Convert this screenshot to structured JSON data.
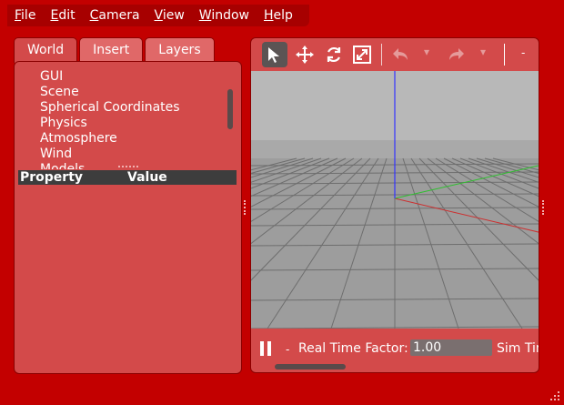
{
  "menu": [
    {
      "underline": "F",
      "rest": "ile"
    },
    {
      "underline": "E",
      "rest": "dit"
    },
    {
      "underline": "C",
      "rest": "amera"
    },
    {
      "underline": "V",
      "rest": "iew"
    },
    {
      "underline": "W",
      "rest": "indow"
    },
    {
      "underline": "H",
      "rest": "elp"
    }
  ],
  "tabs": [
    "World",
    "Insert",
    "Layers"
  ],
  "tree": {
    "items": [
      "GUI",
      "Scene",
      "Spherical Coordinates",
      "Physics",
      "Atmosphere",
      "Wind"
    ],
    "partial_item": "Models"
  },
  "property_table": {
    "col_property": "Property",
    "col_value": "Value"
  },
  "toolbar": {
    "tools": [
      "select-arrow-icon",
      "translate-icon",
      "rotate-icon",
      "scale-icon",
      "undo-icon",
      "redo-icon"
    ],
    "dash": "-"
  },
  "bottom": {
    "dash": "-",
    "rtf_label": "Real Time Factor:",
    "rtf_value": "1.00",
    "sim_label": "Sim Time"
  },
  "colors": {
    "window_bg": "#c30000",
    "panel_bg": "#d34a4a",
    "viewport_sky": "#b8b8b8",
    "viewport_ground": "#9a9a9a",
    "axis_x": "#d23030",
    "axis_y": "#30c030",
    "axis_z": "#3030ff"
  }
}
